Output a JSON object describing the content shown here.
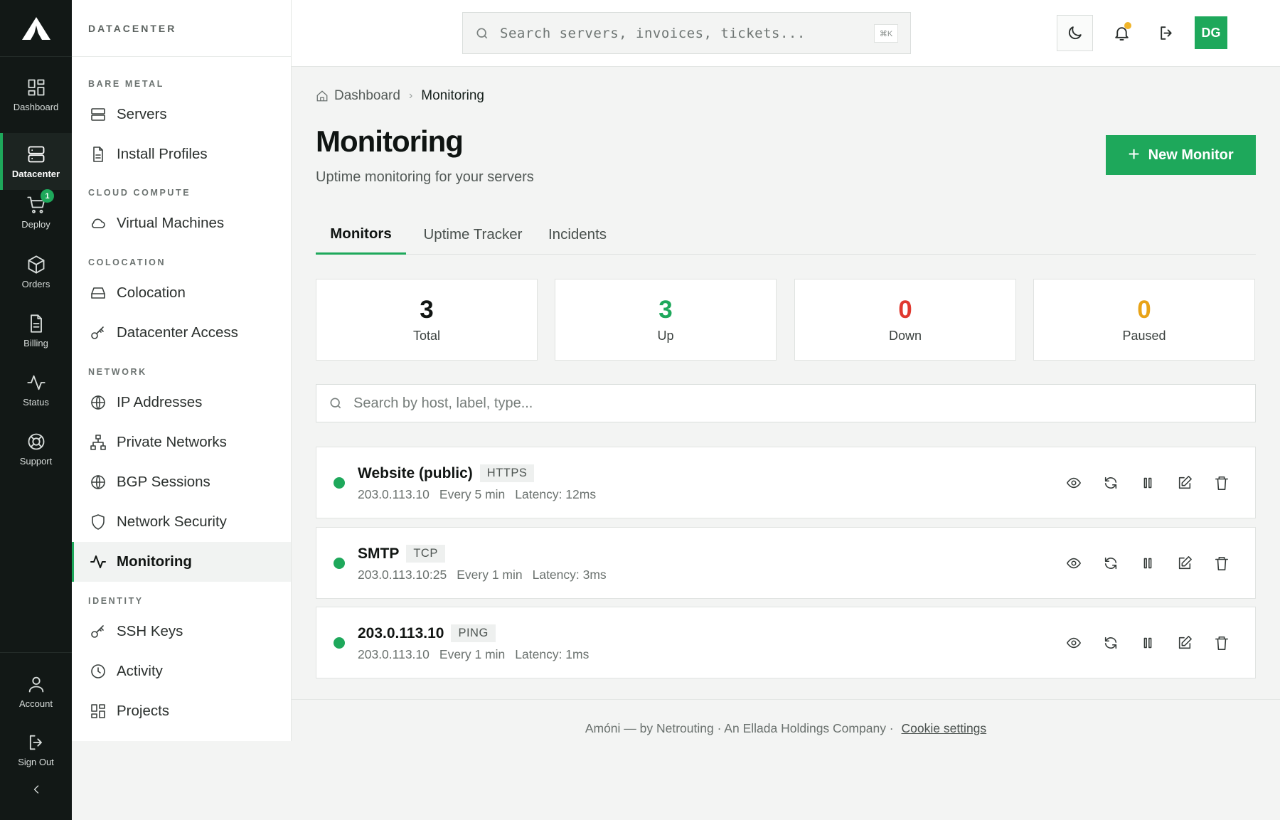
{
  "rail": {
    "items": [
      {
        "label": "Dashboard",
        "icon": "dashboard-grid-icon"
      },
      {
        "label": "Datacenter",
        "icon": "server-stack-icon"
      },
      {
        "label": "Deploy",
        "icon": "cart-icon",
        "badge": "1"
      },
      {
        "label": "Orders",
        "icon": "box-icon"
      },
      {
        "label": "Billing",
        "icon": "document-icon"
      },
      {
        "label": "Status",
        "icon": "activity-icon"
      },
      {
        "label": "Support",
        "icon": "lifebuoy-icon"
      }
    ],
    "bottom": [
      {
        "label": "Account",
        "icon": "user-icon"
      },
      {
        "label": "Sign Out",
        "icon": "sign-out-icon"
      }
    ]
  },
  "sidebar": {
    "header": "DATACENTER",
    "sections": [
      {
        "title": "BARE METAL"
      },
      {
        "title": "CLOUD COMPUTE"
      },
      {
        "title": "COLOCATION"
      },
      {
        "title": "NETWORK"
      },
      {
        "title": "IDENTITY"
      }
    ],
    "items": [
      {
        "label": "Servers",
        "icon": "server-icon"
      },
      {
        "label": "Install Profiles",
        "icon": "file-icon"
      },
      {
        "label": "Virtual Machines",
        "icon": "cloud-icon"
      },
      {
        "label": "Colocation",
        "icon": "hard-drive-icon"
      },
      {
        "label": "Datacenter Access",
        "icon": "key-icon"
      },
      {
        "label": "IP Addresses",
        "icon": "globe-icon"
      },
      {
        "label": "Private Networks",
        "icon": "network-icon"
      },
      {
        "label": "BGP Sessions",
        "icon": "globe-icon"
      },
      {
        "label": "Network Security",
        "icon": "shield-icon"
      },
      {
        "label": "Monitoring",
        "icon": "activity-icon",
        "active": true
      },
      {
        "label": "SSH Keys",
        "icon": "key-icon"
      },
      {
        "label": "Activity",
        "icon": "clock-icon"
      },
      {
        "label": "Projects",
        "icon": "grid-icon"
      }
    ]
  },
  "topbar": {
    "search_placeholder": "Search servers, invoices, tickets...",
    "shortcut": "⌘K",
    "avatar_initials": "DG"
  },
  "breadcrumb": {
    "home": "Dashboard",
    "current": "Monitoring"
  },
  "page": {
    "title": "Monitoring",
    "subtitle": "Uptime monitoring for your servers",
    "new_button": "New Monitor"
  },
  "tabs": [
    {
      "label": "Monitors",
      "active": true
    },
    {
      "label": "Uptime Tracker"
    },
    {
      "label": "Incidents"
    }
  ],
  "stats": [
    {
      "value": "3",
      "label": "Total",
      "color": "#111513"
    },
    {
      "value": "3",
      "label": "Up",
      "color": "#1ea85b"
    },
    {
      "value": "0",
      "label": "Down",
      "color": "#e0382f"
    },
    {
      "value": "0",
      "label": "Paused",
      "color": "#e8a317"
    }
  ],
  "filter": {
    "placeholder": "Search by host, label, type..."
  },
  "monitors": [
    {
      "name": "Website (public)",
      "type": "HTTPS",
      "host": "203.0.113.10",
      "interval": "Every 5 min",
      "latency": "Latency: 12ms",
      "status_color": "#1ea85b"
    },
    {
      "name": "SMTP",
      "type": "TCP",
      "host": "203.0.113.10:25",
      "interval": "Every 1 min",
      "latency": "Latency: 3ms",
      "status_color": "#1ea85b"
    },
    {
      "name": "203.0.113.10",
      "type": "PING",
      "host": "203.0.113.10",
      "interval": "Every 1 min",
      "latency": "Latency: 1ms",
      "status_color": "#1ea85b"
    }
  ],
  "footer": {
    "text": "Amóni — by Netrouting · An Ellada Holdings Company  ·",
    "link": "Cookie settings"
  },
  "colors": {
    "accent": "#1ea85b",
    "rail_bg": "#121816"
  }
}
